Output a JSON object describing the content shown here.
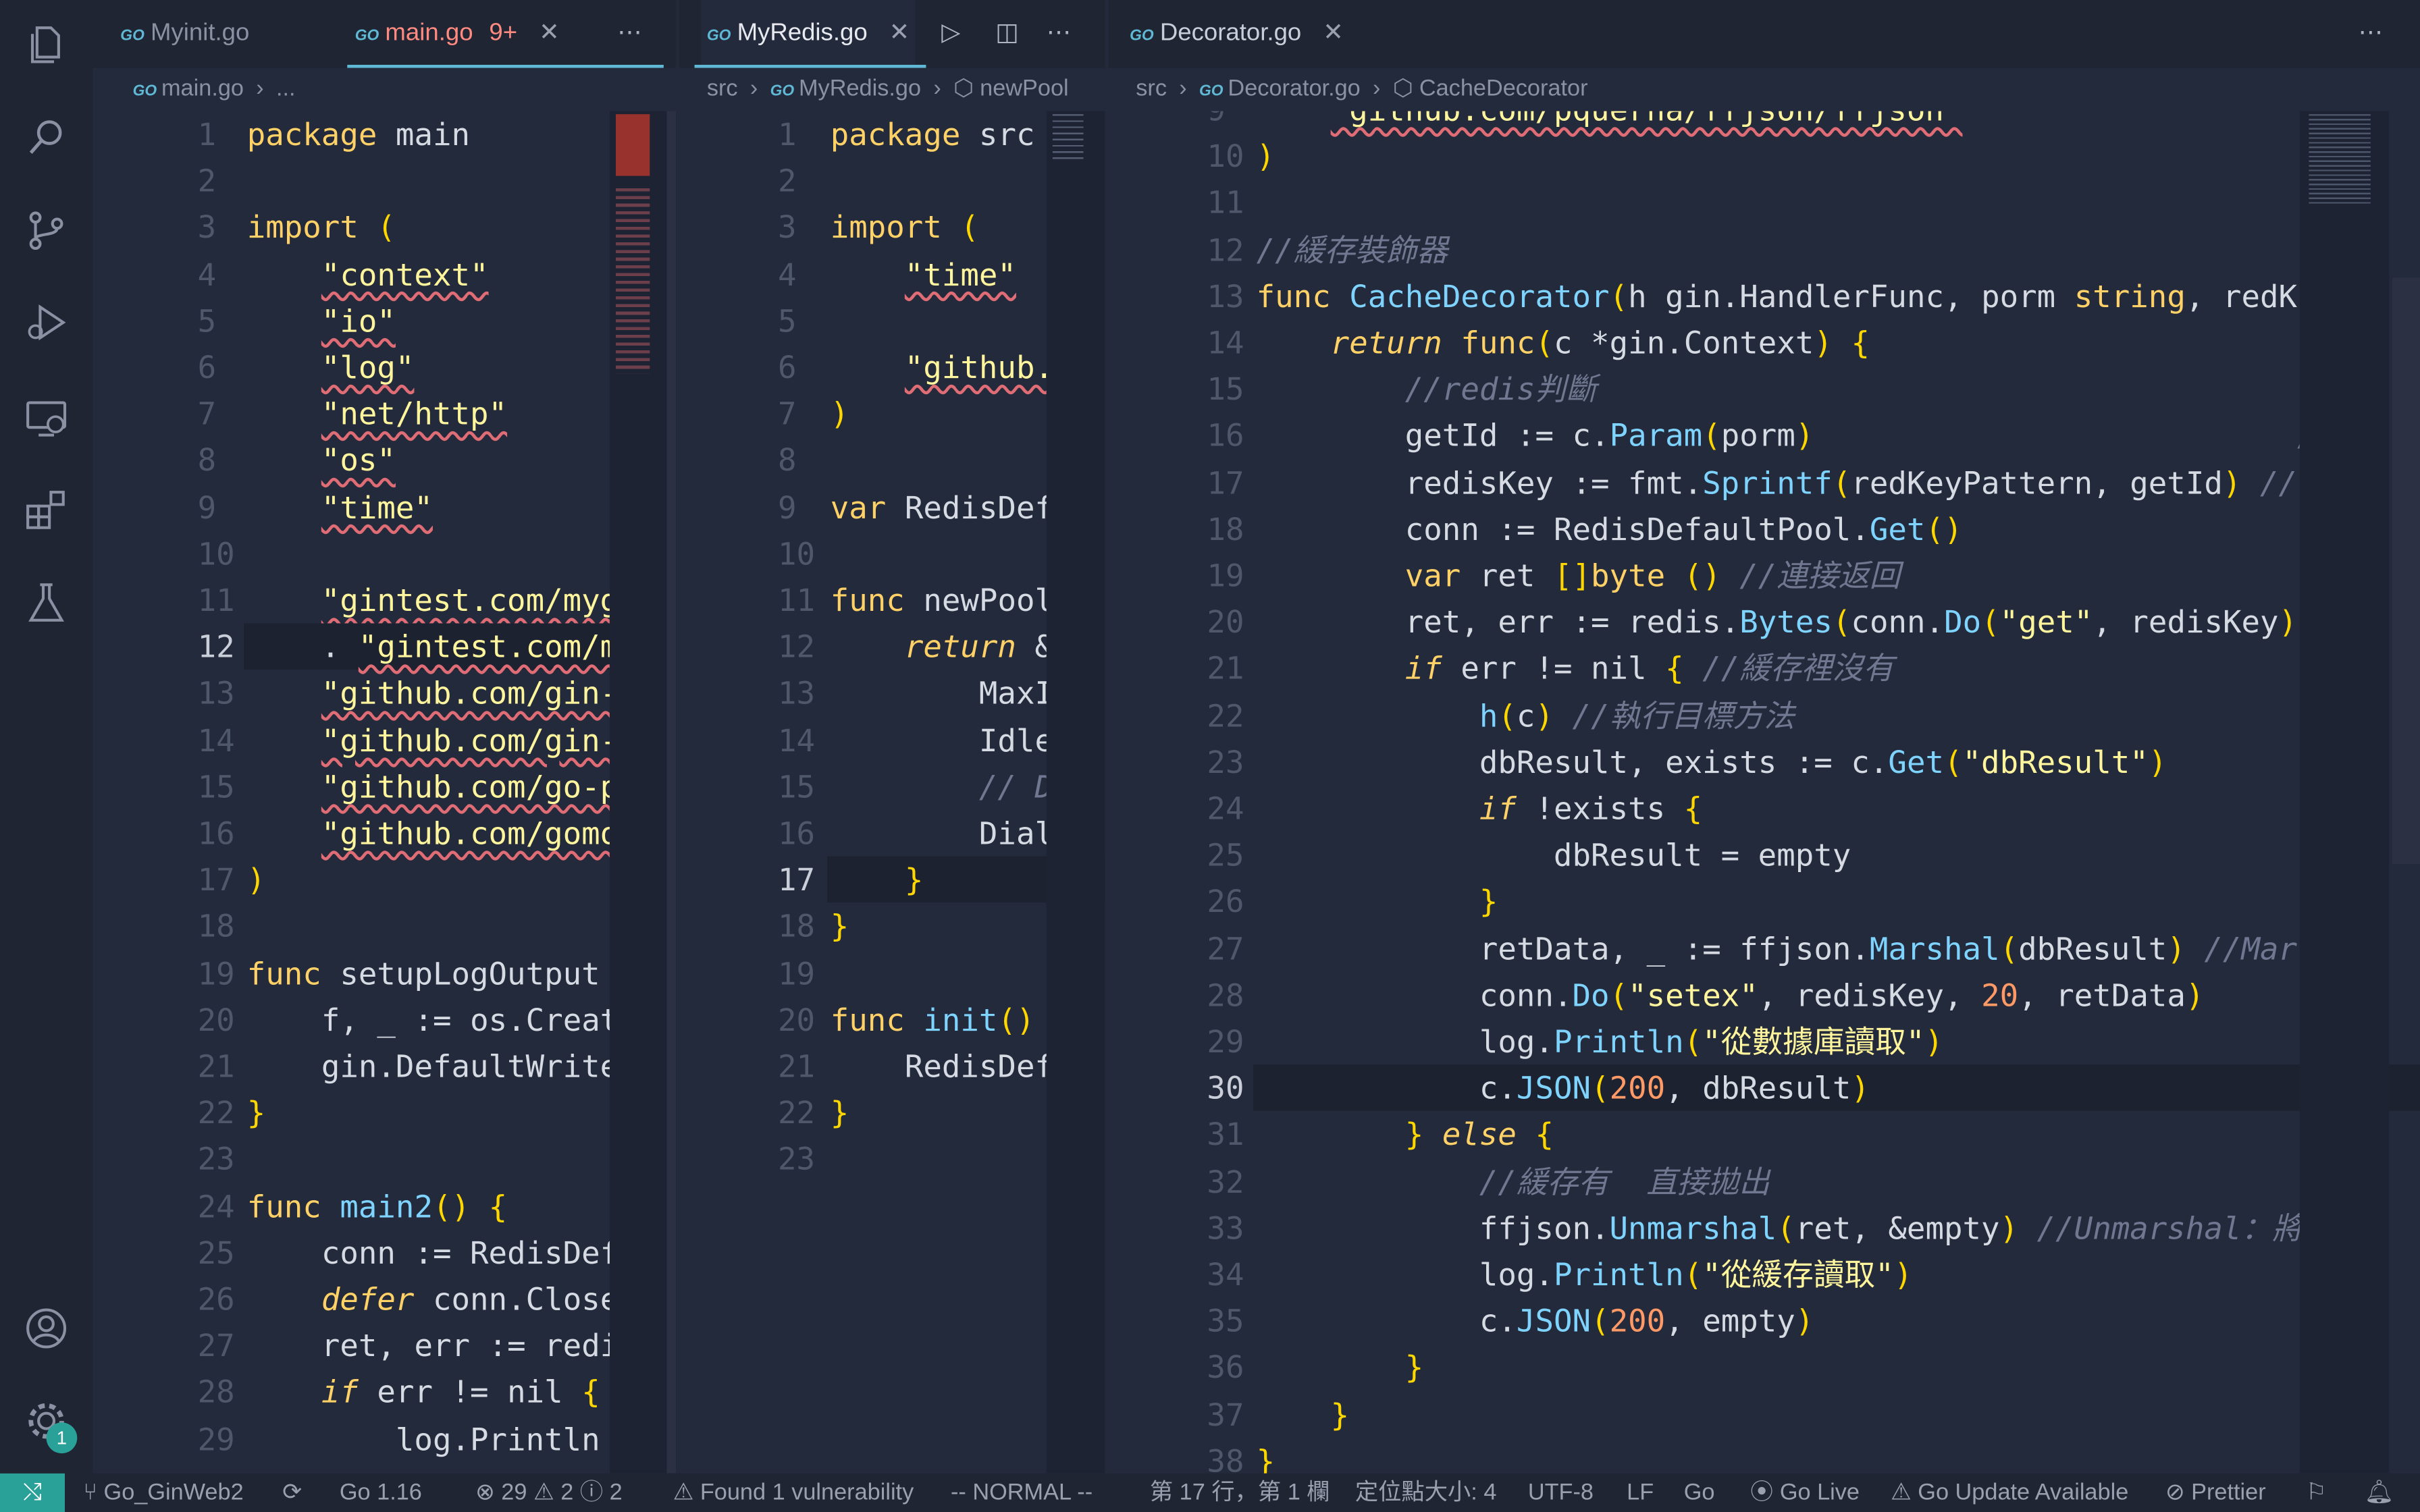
{
  "activity_bar": {
    "items": [
      "explorer-icon",
      "search-icon",
      "source-control-icon",
      "run-debug-icon",
      "remote-explorer-icon",
      "extensions-icon",
      "testing-icon"
    ],
    "bottom": [
      "account-icon",
      "settings-icon"
    ],
    "settings_badge": "1"
  },
  "pane1": {
    "tabs": [
      {
        "icon": "GO",
        "label": "Myinit.go"
      },
      {
        "icon": "GO",
        "label": "main.go",
        "status": "9+"
      }
    ],
    "breadcrumb": {
      "icon": "GO",
      "file": "main.go",
      "more": "..."
    },
    "lines": [
      {
        "n": "1",
        "code": "package main"
      },
      {
        "n": "2",
        "code": ""
      },
      {
        "n": "3",
        "code": "import ("
      },
      {
        "n": "4",
        "code": "    \"context\""
      },
      {
        "n": "5",
        "code": "    \"io\""
      },
      {
        "n": "6",
        "code": "    \"log\""
      },
      {
        "n": "7",
        "code": "    \"net/http\""
      },
      {
        "n": "8",
        "code": "    \"os\""
      },
      {
        "n": "9",
        "code": "    \"time\""
      },
      {
        "n": "10",
        "code": ""
      },
      {
        "n": "11",
        "code": "    \"gintest.com/myg"
      },
      {
        "n": "12",
        "code": "    . \"gintest.com/m"
      },
      {
        "n": "13",
        "code": "    \"github.com/gin-"
      },
      {
        "n": "14",
        "code": "    \"github.com/gin-"
      },
      {
        "n": "15",
        "code": "    \"github.com/go-p"
      },
      {
        "n": "16",
        "code": "    \"github.com/gomo"
      },
      {
        "n": "17",
        "code": ")"
      },
      {
        "n": "18",
        "code": ""
      },
      {
        "n": "19",
        "code": "func setupLogOutput"
      },
      {
        "n": "20",
        "code": "    f, _ := os.Creat"
      },
      {
        "n": "21",
        "code": "    gin.DefaultWrite"
      },
      {
        "n": "22",
        "code": "}"
      },
      {
        "n": "23",
        "code": ""
      },
      {
        "n": "24",
        "code": "func main2() {"
      },
      {
        "n": "25",
        "code": "    conn := RedisDef"
      },
      {
        "n": "26",
        "code": "    defer conn.Close"
      },
      {
        "n": "27",
        "code": "    ret, err := redi"
      },
      {
        "n": "28",
        "code": "    if err != nil {"
      },
      {
        "n": "29",
        "code": "        log.Println"
      }
    ]
  },
  "pane2": {
    "tabs": [
      {
        "icon": "GO",
        "label": "MyRedis.go"
      }
    ],
    "breadcrumb": [
      "src",
      "MyRedis.go",
      "newPool"
    ],
    "lines": [
      {
        "n": "1",
        "code": "package src"
      },
      {
        "n": "2",
        "code": ""
      },
      {
        "n": "3",
        "code": "import ("
      },
      {
        "n": "4",
        "code": "    \"time\""
      },
      {
        "n": "5",
        "code": ""
      },
      {
        "n": "6",
        "code": "    \"github."
      },
      {
        "n": "7",
        "code": ")"
      },
      {
        "n": "8",
        "code": ""
      },
      {
        "n": "9",
        "code": "var RedisDef"
      },
      {
        "n": "10",
        "code": ""
      },
      {
        "n": "11",
        "code": "func newPool"
      },
      {
        "n": "12",
        "code": "    return &"
      },
      {
        "n": "13",
        "code": "        MaxI"
      },
      {
        "n": "14",
        "code": "        Idle"
      },
      {
        "n": "15",
        "code": "        // D"
      },
      {
        "n": "16",
        "code": "        Dial"
      },
      {
        "n": "17",
        "code": "    }"
      },
      {
        "n": "18",
        "code": "}"
      },
      {
        "n": "19",
        "code": ""
      },
      {
        "n": "20",
        "code": "func init()"
      },
      {
        "n": "21",
        "code": "    RedisDef"
      },
      {
        "n": "22",
        "code": "}"
      },
      {
        "n": "23",
        "code": ""
      }
    ]
  },
  "pane3": {
    "tabs": [
      {
        "icon": "GO",
        "label": "Decorator.go"
      }
    ],
    "breadcrumb": [
      "src",
      "Decorator.go",
      "CacheDecorator"
    ],
    "lines": [
      {
        "n": "9",
        "code": "    \"github.com/pquerna/ffjson/ffjson\""
      },
      {
        "n": "10",
        "code": ")"
      },
      {
        "n": "11",
        "code": ""
      },
      {
        "n": "12",
        "code": "//緩存裝飾器"
      },
      {
        "n": "13",
        "code": "func CacheDecorator(h gin.HandlerFunc, porm string, redK"
      },
      {
        "n": "14",
        "code": "    return func(c *gin.Context) {"
      },
      {
        "n": "15",
        "code": "        //redis判斷"
      },
      {
        "n": "16",
        "code": "        getId := c.Param(porm)                          //"
      },
      {
        "n": "17",
        "code": "        redisKey := fmt.Sprintf(redKeyPattern, getId) //"
      },
      {
        "n": "18",
        "code": "        conn := RedisDefaultPool.Get()"
      },
      {
        "n": "19",
        "code": "        var ret []byte () //連接返回"
      },
      {
        "n": "20",
        "code": "        ret, err := redis.Bytes(conn.Do(\"get\", redisKey)"
      },
      {
        "n": "21",
        "code": "        if err != nil { //緩存裡沒有"
      },
      {
        "n": "22",
        "code": "            h(c) //執行目標方法"
      },
      {
        "n": "23",
        "code": "            dbResult, exists := c.Get(\"dbResult\")"
      },
      {
        "n": "24",
        "code": "            if !exists {"
      },
      {
        "n": "25",
        "code": "                dbResult = empty"
      },
      {
        "n": "26",
        "code": "            }"
      },
      {
        "n": "27",
        "code": "            retData, _ := ffjson.Marshal(dbResult) //Mar"
      },
      {
        "n": "28",
        "code": "            conn.Do(\"setex\", redisKey, 20, retData)"
      },
      {
        "n": "29",
        "code": "            log.Println(\"從數據庫讀取\")"
      },
      {
        "n": "30",
        "code": "            c.JSON(200, dbResult)"
      },
      {
        "n": "31",
        "code": "        } else {"
      },
      {
        "n": "32",
        "code": "            //緩存有  直接拋出"
      },
      {
        "n": "33",
        "code": "            ffjson.Unmarshal(ret, &empty) //Unmarshal：將"
      },
      {
        "n": "34",
        "code": "            log.Println(\"從緩存讀取\")"
      },
      {
        "n": "35",
        "code": "            c.JSON(200, empty)"
      },
      {
        "n": "36",
        "code": "        }"
      },
      {
        "n": "37",
        "code": "    }"
      },
      {
        "n": "38",
        "code": "}"
      }
    ]
  },
  "statusbar": {
    "branch": "Go_GinWeb2",
    "go_version": "Go 1.16",
    "errors": "29",
    "warnings": "2",
    "infos": "2",
    "vuln": "Found 1 vulnerability",
    "mode": "-- NORMAL --",
    "position": "第 17 行，第 1 欄",
    "indent": "定位點大小: 4",
    "encoding": "UTF-8",
    "eol": "LF",
    "language": "Go",
    "golive": "Go Live",
    "update": "Go Update Available",
    "prettier": "Prettier"
  },
  "colors": {
    "background": "#232a3b",
    "keyword": "#ffd166",
    "string": "#fff59d",
    "function": "#7fd3ff",
    "number": "#ff9966",
    "comment": "#6f7890",
    "accent": "#2aa198"
  }
}
